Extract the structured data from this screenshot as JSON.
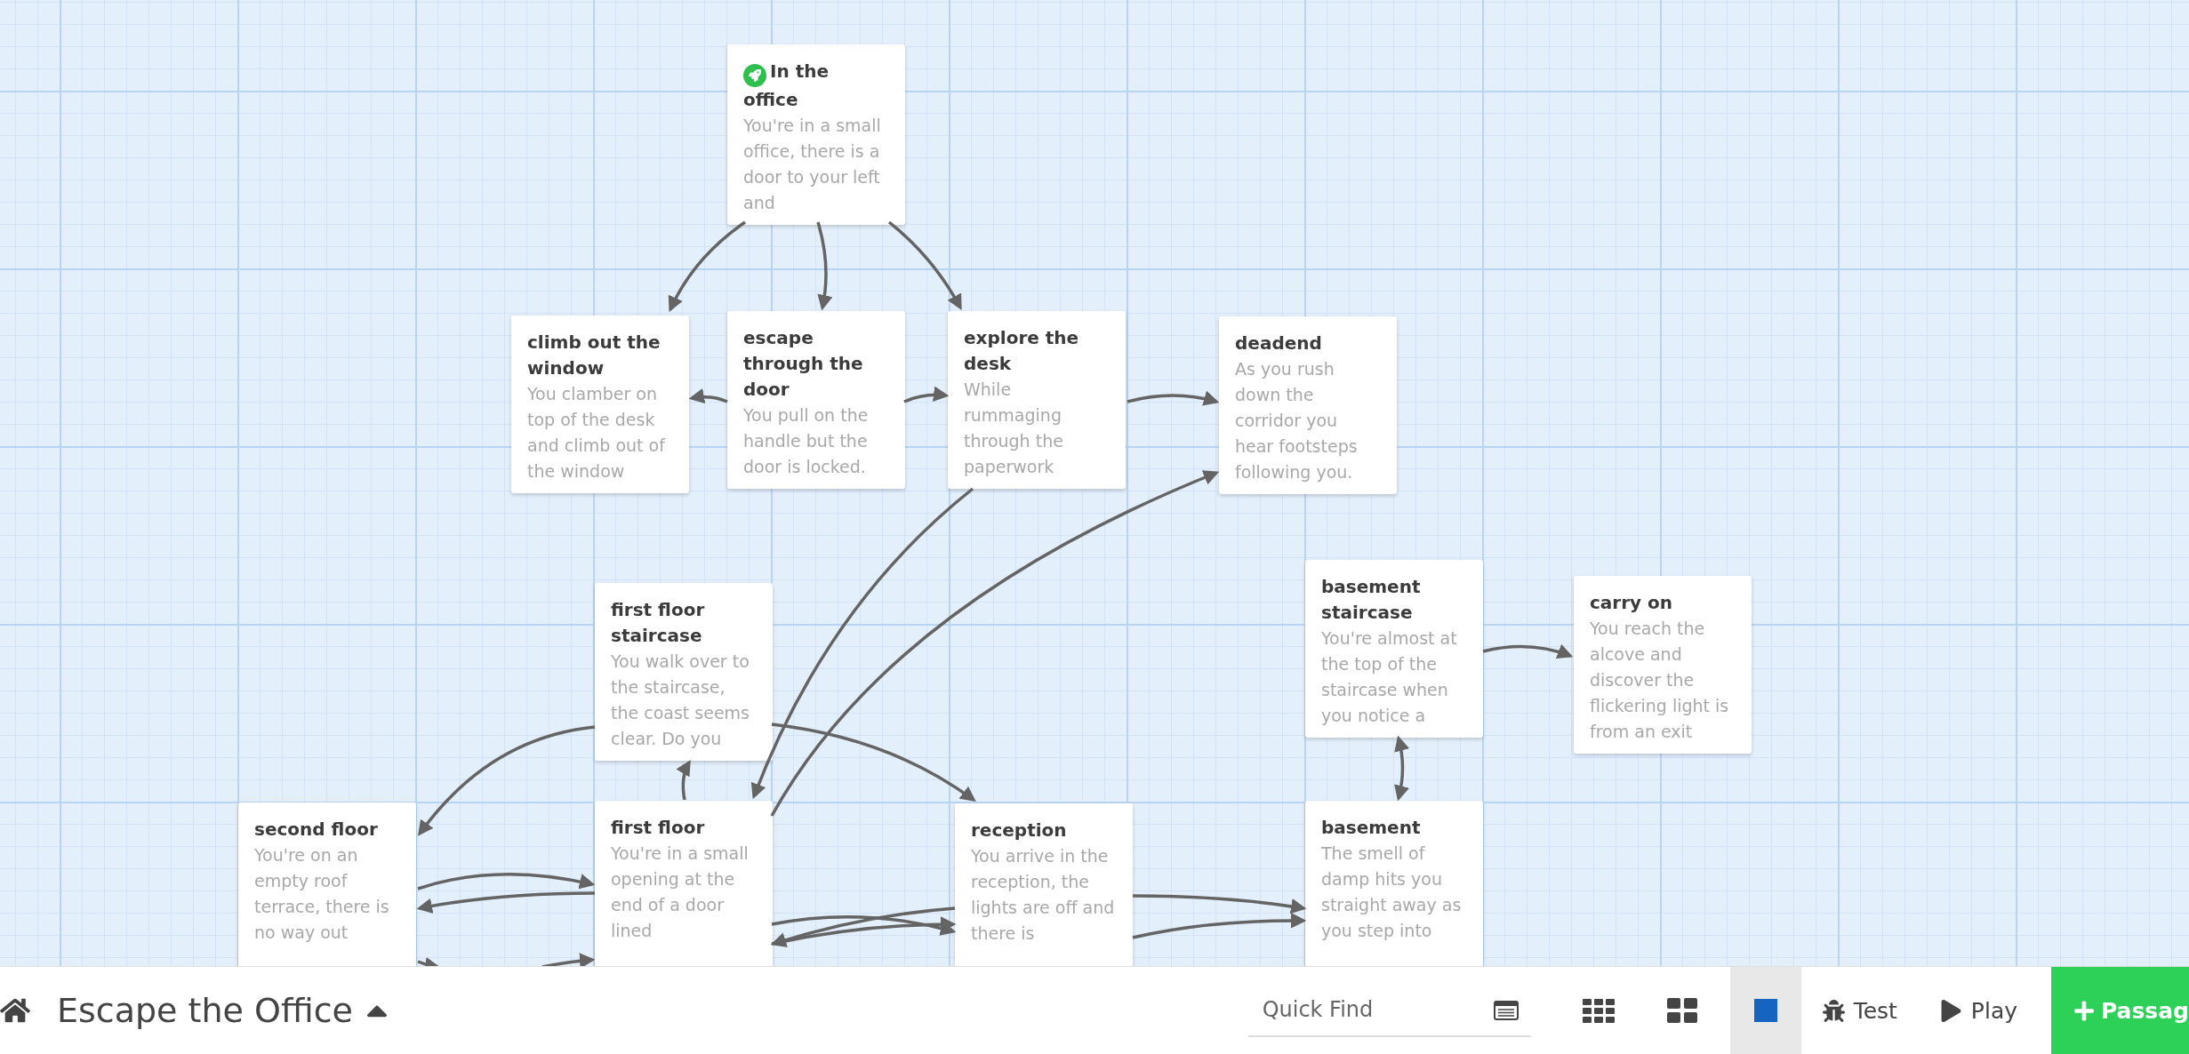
{
  "passages": [
    {
      "title": "In the office",
      "start": true,
      "excerpt": "You're in a small office, there is a door to your left and"
    },
    {
      "title": "climb out the window",
      "start": false,
      "excerpt": "You clamber on top of the desk and climb out of the window"
    },
    {
      "title": "escape through the door",
      "start": false,
      "excerpt": "You pull on the handle but the door is locked."
    },
    {
      "title": "explore the desk",
      "start": false,
      "excerpt": "While rummaging through the paperwork"
    },
    {
      "title": "deadend",
      "start": false,
      "excerpt": "As you rush down the corridor you hear footsteps following you."
    },
    {
      "title": "first floor staircase",
      "start": false,
      "excerpt": "You walk over to the staircase, the coast seems clear. Do you"
    },
    {
      "title": "basement staircase",
      "start": false,
      "excerpt": "You're almost at the top of the staircase when you notice a"
    },
    {
      "title": "carry on",
      "start": false,
      "excerpt": "You reach the alcove and discover the flickering light is from an exit"
    },
    {
      "title": "second floor",
      "start": false,
      "excerpt": "You're on an empty roof terrace, there is no way out"
    },
    {
      "title": "first floor",
      "start": false,
      "excerpt": "You're in a small opening at the end of a door lined"
    },
    {
      "title": "reception",
      "start": false,
      "excerpt": "You arrive in the reception, the lights are off and there is"
    },
    {
      "title": "basement",
      "start": false,
      "excerpt": "The smell of damp hits you straight away as you step into"
    }
  ],
  "toolbar": {
    "story_title": "Escape the Office",
    "quick_find": {
      "placeholder": "Quick Find"
    },
    "zoom_levels": [
      {
        "kind": "small",
        "selected": false
      },
      {
        "kind": "medium",
        "selected": false
      },
      {
        "kind": "large",
        "selected": true
      }
    ],
    "test_button": "Test",
    "play_button": "Play",
    "add_button": "Passag"
  }
}
